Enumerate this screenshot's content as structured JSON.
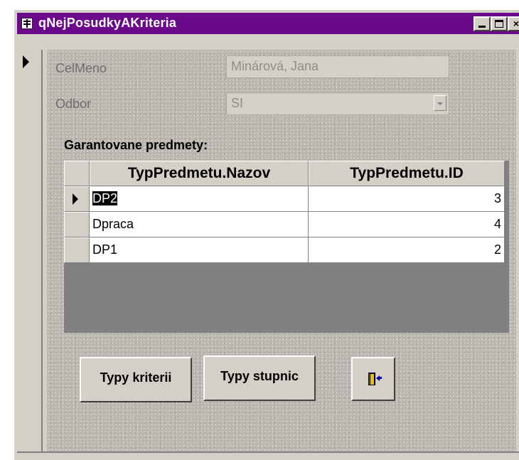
{
  "window": {
    "title": "qNejPosudkyAKriteria",
    "title_bar_color": "#6a0a8a",
    "controls": {
      "minimize": "minimize-icon",
      "maximize": "maximize-icon",
      "close": "close-icon"
    },
    "close_glyph": "×"
  },
  "form": {
    "fields": [
      {
        "label": "CelMeno",
        "value": "Minárová, Jana"
      },
      {
        "label": "Odbor",
        "value": "SI"
      }
    ],
    "subform_label": "Garantovane predmety:",
    "subform": {
      "columns": [
        "TypPredmetu.Nazov",
        "TypPredmetu.ID"
      ],
      "rows": [
        {
          "nazov": "DP2",
          "id": "3",
          "current": true
        },
        {
          "nazov": "Dpraca",
          "id": "4"
        },
        {
          "nazov": "DP1",
          "id": "2"
        }
      ]
    },
    "buttons": [
      {
        "label": "Typy kriterii"
      },
      {
        "label": "Typy stupnic"
      },
      {
        "label": "",
        "icon": "exit-door-icon"
      }
    ]
  }
}
